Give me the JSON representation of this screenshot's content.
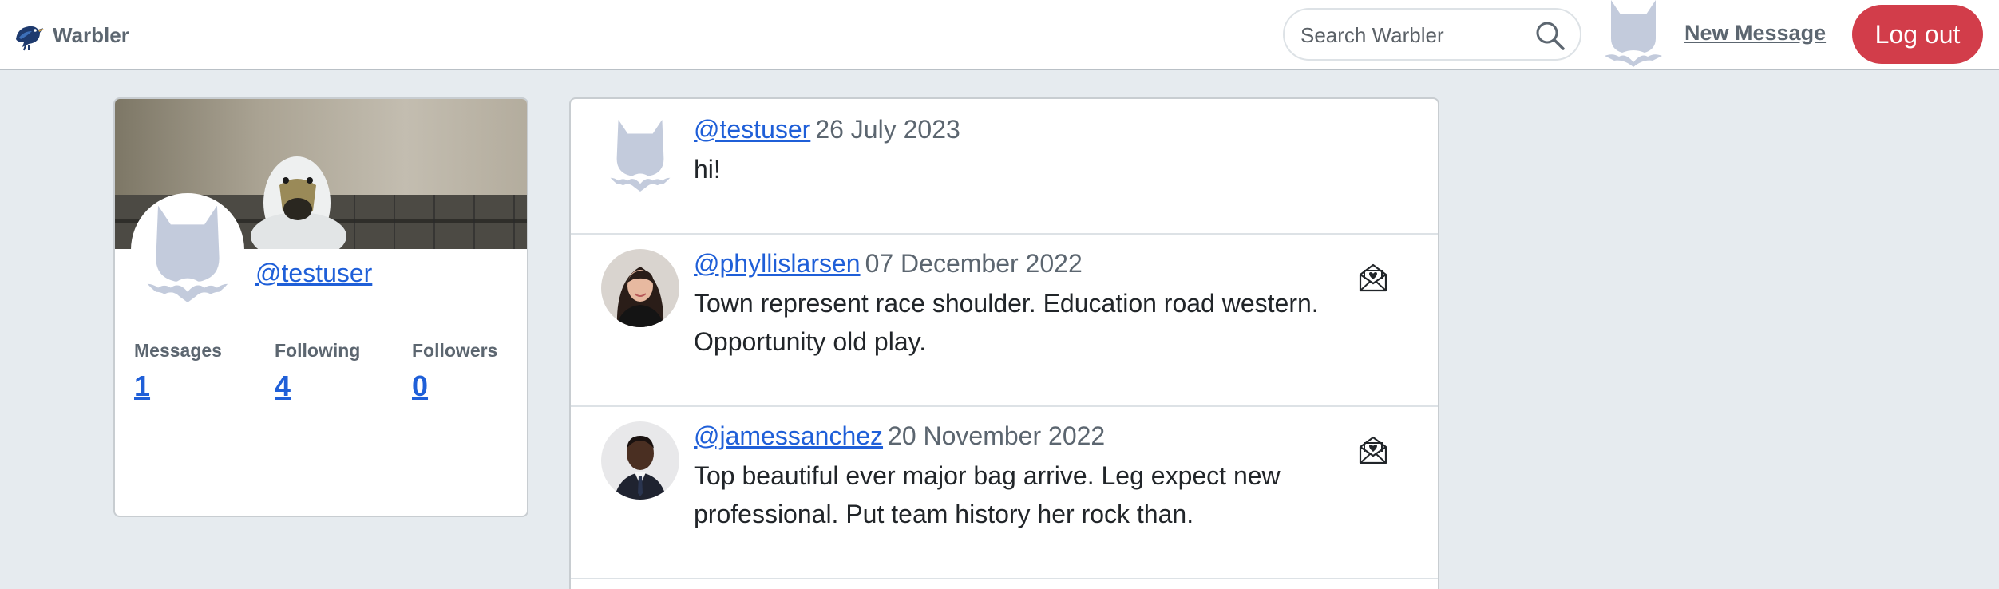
{
  "navbar": {
    "brand": "Warbler",
    "search_placeholder": "Search Warbler",
    "new_message": "New Message",
    "logout": "Log out"
  },
  "profile": {
    "username": "@testuser",
    "stats": [
      {
        "label": "Messages",
        "value": "1"
      },
      {
        "label": "Following",
        "value": "4"
      },
      {
        "label": "Followers",
        "value": "0"
      }
    ]
  },
  "messages": [
    {
      "user": "@testuser",
      "date": "26 July 2023",
      "text": "hi!",
      "avatar": "default-avatar",
      "liked": false,
      "show_like": false
    },
    {
      "user": "@phyllislarsen",
      "date": "07 December 2022",
      "text": "Town represent race shoulder. Education road western. Opportunity old play.",
      "avatar": "photo-woman",
      "show_like": true
    },
    {
      "user": "@jamessanchez",
      "date": "20 November 2022",
      "text": "Top beautiful ever major bag arrive. Leg expect new professional. Put team history her rock than.",
      "avatar": "photo-man",
      "show_like": true
    }
  ],
  "colors": {
    "page_bg": "#e6ebef",
    "link": "#1f5fd8",
    "logout_bg": "#d23d4a",
    "muted": "#5c6670",
    "avatar_placeholder": "#c3cbdc"
  },
  "icons": [
    "bird-logo-icon",
    "search-icon",
    "default-avatar-icon",
    "envelope-heart-icon"
  ]
}
